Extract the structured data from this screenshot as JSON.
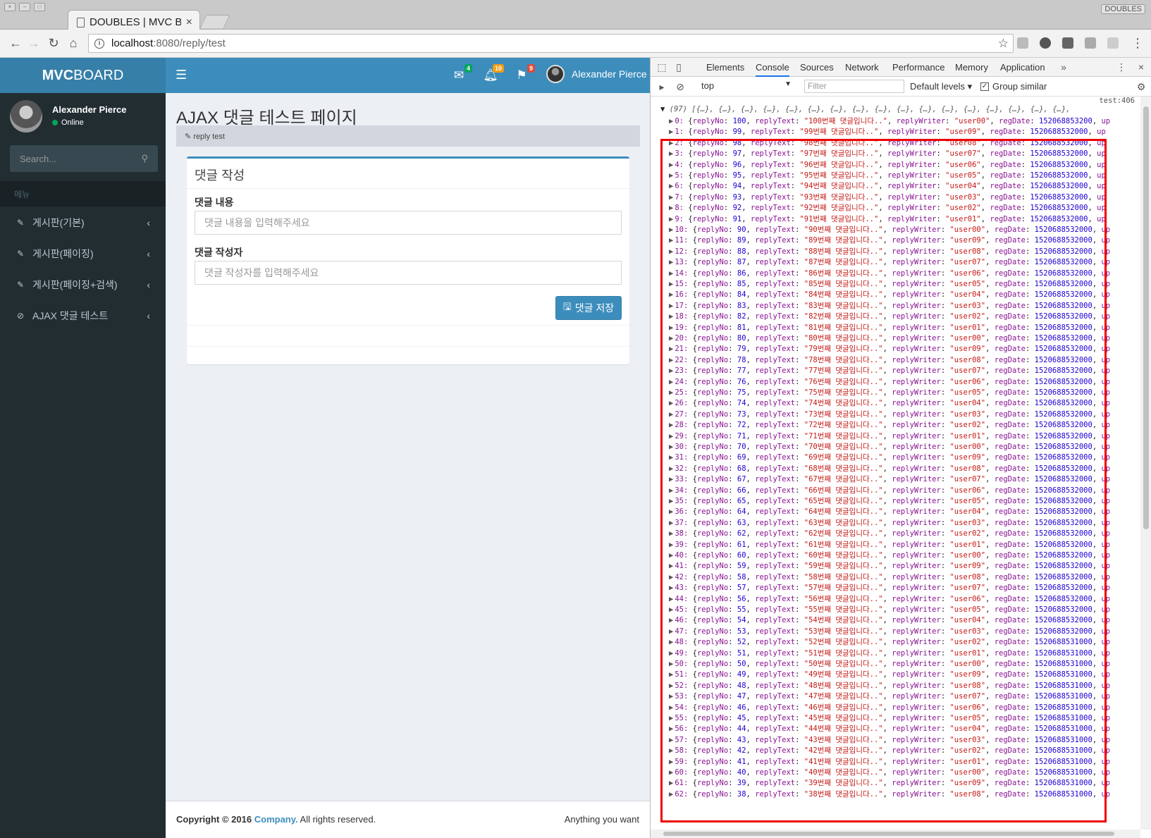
{
  "browser": {
    "tab_title": "DOUBLES | MVC BOARD",
    "url_host": "localhost",
    "url_path": ":8080/reply/test",
    "window_label": "DOUBLES"
  },
  "app": {
    "brand_bold": "MVC",
    "brand_rest": "BOARD",
    "user_name": "Alexander Pierce",
    "user_status": "Online",
    "search_placeholder": "Search...",
    "menu_header": "메뉴",
    "menu": [
      {
        "label": "게시판(기본)"
      },
      {
        "label": "게시판(페이징)"
      },
      {
        "label": "게시판(페이징+검색)"
      },
      {
        "label": "AJAX 댓글 테스트"
      }
    ],
    "notifications": {
      "messages": "4",
      "alerts": "10",
      "flags": "9"
    },
    "colors": {
      "primary": "#3c8dbc",
      "brand": "#367fa9",
      "sidebar": "#222d32",
      "success": "#00a65a",
      "warning": "#f39c12",
      "danger": "#dd4b39"
    }
  },
  "content": {
    "page_title": "AJAX 댓글 테스트 페이지",
    "breadcrumb": "reply test",
    "box_title": "댓글 작성",
    "reply_text_label": "댓글 내용",
    "reply_text_placeholder": "댓글 내용을 입력해주세요",
    "reply_writer_label": "댓글 작성자",
    "reply_writer_placeholder": "댓글 작성자를 입력해주세요",
    "save_label": "댓글 저장"
  },
  "footer": {
    "copyright_prefix": "Copyright © 2016",
    "company": "Company.",
    "rights": "All rights reserved.",
    "right_text": "Anything you want"
  },
  "devtools": {
    "tabs": [
      "Elements",
      "Console",
      "Sources",
      "Network",
      "Performance",
      "Memory",
      "Application"
    ],
    "active_tab": "Console",
    "context": "top",
    "filter_placeholder": "Filter",
    "levels": "Default levels",
    "group_similar": "Group similar",
    "source_link": "test:406",
    "array_summary": "(97) [{…}, {…}, {…}, {…}, {…}, {…}, {…}, {…}, {…}, {…}, {…}, {…}, {…}, {…}, {…}, {…}, {…},",
    "rows": [
      {
        "i": 0,
        "no": 100,
        "w": "user00",
        "d": "152068853200"
      },
      {
        "i": 1,
        "no": 99,
        "w": "user09",
        "d": "1520688532000"
      },
      {
        "i": 2,
        "no": 98,
        "w": "user08",
        "d": "1520688532000"
      },
      {
        "i": 3,
        "no": 97,
        "w": "user07",
        "d": "1520688532000"
      },
      {
        "i": 4,
        "no": 96,
        "w": "user06",
        "d": "1520688532000"
      },
      {
        "i": 5,
        "no": 95,
        "w": "user05",
        "d": "1520688532000"
      },
      {
        "i": 6,
        "no": 94,
        "w": "user04",
        "d": "1520688532000"
      },
      {
        "i": 7,
        "no": 93,
        "w": "user03",
        "d": "1520688532000"
      },
      {
        "i": 8,
        "no": 92,
        "w": "user02",
        "d": "1520688532000"
      },
      {
        "i": 9,
        "no": 91,
        "w": "user01",
        "d": "1520688532000"
      },
      {
        "i": 10,
        "no": 90,
        "w": "user00",
        "d": "1520688532000"
      },
      {
        "i": 11,
        "no": 89,
        "w": "user09",
        "d": "1520688532000"
      },
      {
        "i": 12,
        "no": 88,
        "w": "user08",
        "d": "1520688532000"
      },
      {
        "i": 13,
        "no": 87,
        "w": "user07",
        "d": "1520688532000"
      },
      {
        "i": 14,
        "no": 86,
        "w": "user06",
        "d": "1520688532000"
      },
      {
        "i": 15,
        "no": 85,
        "w": "user05",
        "d": "1520688532000"
      },
      {
        "i": 16,
        "no": 84,
        "w": "user04",
        "d": "1520688532000"
      },
      {
        "i": 17,
        "no": 83,
        "w": "user03",
        "d": "1520688532000"
      },
      {
        "i": 18,
        "no": 82,
        "w": "user02",
        "d": "1520688532000"
      },
      {
        "i": 19,
        "no": 81,
        "w": "user01",
        "d": "1520688532000"
      },
      {
        "i": 20,
        "no": 80,
        "w": "user00",
        "d": "1520688532000"
      },
      {
        "i": 21,
        "no": 79,
        "w": "user09",
        "d": "1520688532000"
      },
      {
        "i": 22,
        "no": 78,
        "w": "user08",
        "d": "1520688532000"
      },
      {
        "i": 23,
        "no": 77,
        "w": "user07",
        "d": "1520688532000"
      },
      {
        "i": 24,
        "no": 76,
        "w": "user06",
        "d": "1520688532000"
      },
      {
        "i": 25,
        "no": 75,
        "w": "user05",
        "d": "1520688532000"
      },
      {
        "i": 26,
        "no": 74,
        "w": "user04",
        "d": "1520688532000"
      },
      {
        "i": 27,
        "no": 73,
        "w": "user03",
        "d": "1520688532000"
      },
      {
        "i": 28,
        "no": 72,
        "w": "user02",
        "d": "1520688532000"
      },
      {
        "i": 29,
        "no": 71,
        "w": "user01",
        "d": "1520688532000"
      },
      {
        "i": 30,
        "no": 70,
        "w": "user00",
        "d": "1520688532000"
      },
      {
        "i": 31,
        "no": 69,
        "w": "user09",
        "d": "1520688532000"
      },
      {
        "i": 32,
        "no": 68,
        "w": "user08",
        "d": "1520688532000"
      },
      {
        "i": 33,
        "no": 67,
        "w": "user07",
        "d": "1520688532000"
      },
      {
        "i": 34,
        "no": 66,
        "w": "user06",
        "d": "1520688532000"
      },
      {
        "i": 35,
        "no": 65,
        "w": "user05",
        "d": "1520688532000"
      },
      {
        "i": 36,
        "no": 64,
        "w": "user04",
        "d": "1520688532000"
      },
      {
        "i": 37,
        "no": 63,
        "w": "user03",
        "d": "1520688532000"
      },
      {
        "i": 38,
        "no": 62,
        "w": "user02",
        "d": "1520688532000"
      },
      {
        "i": 39,
        "no": 61,
        "w": "user01",
        "d": "1520688532000"
      },
      {
        "i": 40,
        "no": 60,
        "w": "user00",
        "d": "1520688532000"
      },
      {
        "i": 41,
        "no": 59,
        "w": "user09",
        "d": "1520688532000"
      },
      {
        "i": 42,
        "no": 58,
        "w": "user08",
        "d": "1520688532000"
      },
      {
        "i": 43,
        "no": 57,
        "w": "user07",
        "d": "1520688532000"
      },
      {
        "i": 44,
        "no": 56,
        "w": "user06",
        "d": "1520688532000"
      },
      {
        "i": 45,
        "no": 55,
        "w": "user05",
        "d": "1520688532000"
      },
      {
        "i": 46,
        "no": 54,
        "w": "user04",
        "d": "1520688532000"
      },
      {
        "i": 47,
        "no": 53,
        "w": "user03",
        "d": "1520688532000"
      },
      {
        "i": 48,
        "no": 52,
        "w": "user02",
        "d": "1520688531000"
      },
      {
        "i": 49,
        "no": 51,
        "w": "user01",
        "d": "1520688531000"
      },
      {
        "i": 50,
        "no": 50,
        "w": "user00",
        "d": "1520688531000"
      },
      {
        "i": 51,
        "no": 49,
        "w": "user09",
        "d": "1520688531000"
      },
      {
        "i": 52,
        "no": 48,
        "w": "user08",
        "d": "1520688531000"
      },
      {
        "i": 53,
        "no": 47,
        "w": "user07",
        "d": "1520688531000"
      },
      {
        "i": 54,
        "no": 46,
        "w": "user06",
        "d": "1520688531000"
      },
      {
        "i": 55,
        "no": 45,
        "w": "user05",
        "d": "1520688531000"
      },
      {
        "i": 56,
        "no": 44,
        "w": "user04",
        "d": "1520688531000"
      },
      {
        "i": 57,
        "no": 43,
        "w": "user03",
        "d": "1520688531000"
      },
      {
        "i": 58,
        "no": 42,
        "w": "user02",
        "d": "1520688531000"
      },
      {
        "i": 59,
        "no": 41,
        "w": "user01",
        "d": "1520688531000"
      },
      {
        "i": 60,
        "no": 40,
        "w": "user00",
        "d": "1520688531000"
      },
      {
        "i": 61,
        "no": 39,
        "w": "user09",
        "d": "1520688531000"
      },
      {
        "i": 62,
        "no": 38,
        "w": "user08",
        "d": "1520688531000"
      }
    ]
  }
}
